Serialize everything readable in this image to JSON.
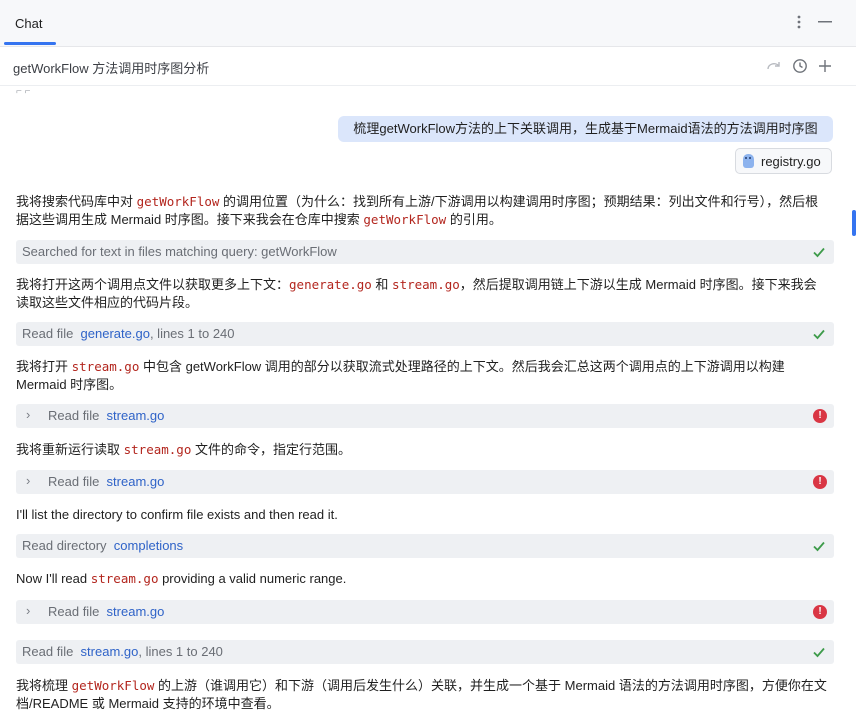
{
  "header": {
    "tab_label": "Chat"
  },
  "conversation": {
    "title": "getWorkFlow 方法调用时序图分析"
  },
  "user_message": {
    "text": "梳理getWorkFlow方法的上下关联调用，生成基于Mermaid语法的方法调用时序图",
    "attachment": "registry.go"
  },
  "messages": [
    {
      "pre": "我将搜索代码库中对 ",
      "code": "getWorkFlow",
      "post1": " 的调用位置（为什么：找到所有上游/下游调用以构建调用时序图；预期结果：列出文件和行号），然后根",
      "post2": "据这些调用生成 Mermaid 时序图。接下来我会在仓库中搜索 ",
      "code2": "getWorkFlow",
      "post3": " 的引用。"
    },
    {
      "pre": "我将打开这两个调用点文件以获取更多上下文：",
      "code": "generate.go",
      "mid": " 和 ",
      "code2": "stream.go",
      "post1": "，然后提取调用链上下游以生成 Mermaid 时序图。接下来我会",
      "post2": "读取这些文件相应的代码片段。"
    },
    {
      "pre": "我将打开 ",
      "code": "stream.go",
      "post1": " 中包含 getWorkFlow 调用的部分以获取流式处理路径的上下文。然后我会汇总这两个调用点的上下游调用以构建",
      "post2": "Mermaid 时序图。"
    },
    {
      "pre": "我将重新运行读取 ",
      "code": "stream.go",
      "post1": " 文件的命令，指定行范围。"
    },
    {
      "text": "I'll list the directory to confirm file exists and then read it."
    },
    {
      "pre": "Now I'll read ",
      "code": "stream.go",
      "post1": " providing a valid numeric range."
    },
    {
      "pre": "我将梳理 ",
      "code": "getWorkFlow",
      "post1": " 的上游（谁调用它）和下游（调用后发生什么）关联，并生成一个基于 Mermaid 语法的方法调用时序图，方便你在文",
      "post2": "档/README 或 Mermaid 支持的环境中查看。"
    }
  ],
  "tools": [
    {
      "label": "Searched for text in files matching query: getWorkFlow",
      "status": "success"
    },
    {
      "label": "Read file",
      "link": "generate.go",
      "suffix": ", lines 1 to 240",
      "status": "success"
    },
    {
      "label": "Read file",
      "link": "stream.go",
      "status": "error"
    },
    {
      "label": "Read file",
      "link": "stream.go",
      "status": "error"
    },
    {
      "label": "Read directory",
      "link": "completions",
      "status": "success"
    },
    {
      "label": "Read file",
      "link": "stream.go",
      "status": "error"
    },
    {
      "label": "Read file",
      "link": "stream.go",
      "suffix": ", lines 1 to 240",
      "status": "success"
    }
  ],
  "icons": {
    "more": "more-vertical-icon",
    "minimize": "minimize-icon",
    "redo": "redo-icon",
    "history": "history-icon",
    "new_chat": "plus-icon",
    "check": "check-icon",
    "error": "error-icon",
    "expand": "chevron-right-icon"
  },
  "colors": {
    "accent": "#3574f0",
    "success": "#3d9b4a",
    "error": "#d93644",
    "code": "#b3261e",
    "link": "#2f63c8",
    "user_bubble": "#dbe6fb"
  }
}
